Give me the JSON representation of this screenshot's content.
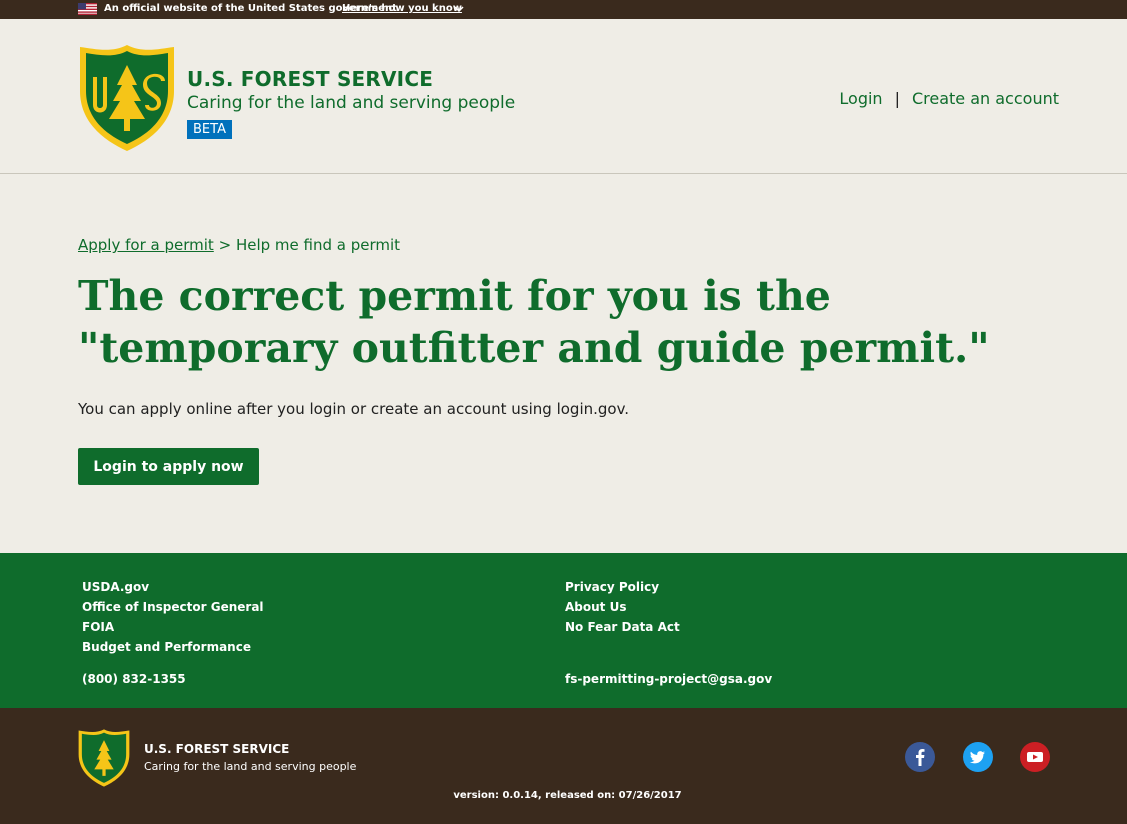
{
  "gov_banner": {
    "official_text": "An official website of the United States government",
    "how_you_know": "Here's how you know"
  },
  "header": {
    "agency_name": "U.S. FOREST SERVICE",
    "tagline": "Caring for the land and serving people",
    "beta_badge": "BETA",
    "nav": {
      "login": "Login",
      "separator": "|",
      "create_account": "Create an account"
    }
  },
  "breadcrumb": {
    "link": "Apply for a permit",
    "separator": ">",
    "current": "Help me find a permit"
  },
  "main": {
    "title": "The correct permit for you is the \"temporary outfitter and guide permit.\"",
    "lede": "You can apply online after you login or create an account using login.gov.",
    "cta_label": "Login to apply now"
  },
  "footer": {
    "col1": [
      "USDA.gov",
      "Office of Inspector General",
      "FOIA",
      "Budget and Performance"
    ],
    "col2": [
      "Privacy Policy",
      "About Us",
      "No Fear Data Act"
    ],
    "phone": "(800) 832-1355",
    "email": "fs-permitting-project@gsa.gov"
  },
  "bottom": {
    "agency_name": "U.S. FOREST SERVICE",
    "tagline": "Caring for the land and serving people",
    "social": [
      "facebook-icon",
      "twitter-icon",
      "youtube-icon"
    ],
    "version": "version: 0.0.14, released on: 07/26/2017"
  },
  "colors": {
    "forest_green": "#0f6c2c",
    "brown": "#3a2a1d",
    "background": "#efede6",
    "beta_blue": "#0071bc",
    "shield_gold": "#f5c518"
  }
}
